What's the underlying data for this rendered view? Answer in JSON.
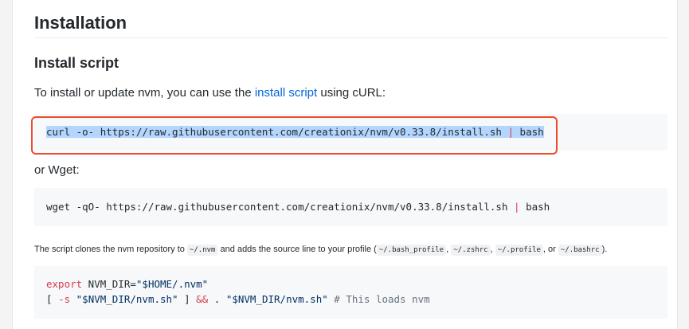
{
  "heading": "Installation",
  "subheading": "Install script",
  "intro": {
    "before": "To install or update nvm, you can use the ",
    "link": "install script",
    "after": " using cURL:"
  },
  "curl_block": {
    "command": "curl -o- https://raw.githubusercontent.com/creationix/nvm/v0.33.8/install.sh",
    "pipe": "|",
    "tail": "bash"
  },
  "wget_label": "or Wget:",
  "wget_block": {
    "command": "wget -qO- https://raw.githubusercontent.com/creationix/nvm/v0.33.8/install.sh",
    "pipe": "|",
    "tail": "bash"
  },
  "note": {
    "t1": "The script clones the nvm repository to ",
    "c1": "~/.nvm",
    "t2": " and adds the source line to your profile (",
    "c2": "~/.bash_profile",
    "t3": ", ",
    "c3": "~/.zshrc",
    "t4": ", ",
    "c4": "~/.profile",
    "t5": ", or ",
    "c5": "~/.bashrc",
    "t6": ")."
  },
  "export_block": {
    "line1_kw": "export",
    "line1_rest": " NVM_DIR=",
    "line1_str": "\"$HOME/.nvm\"",
    "line2_a": "[ ",
    "line2_flag": "-s",
    "line2_str1": " \"$NVM_DIR/nvm.sh\"",
    "line2_b": " ] ",
    "line2_and": "&&",
    "line2_c": " . ",
    "line2_str2": "\"$NVM_DIR/nvm.sh\"",
    "line2_comment": " # This loads nvm"
  },
  "colors": {
    "link": "#0366d6",
    "highlight_border": "#ee4b2b",
    "selection": "#b4d5fe",
    "code_bg": "#f6f8fa"
  }
}
